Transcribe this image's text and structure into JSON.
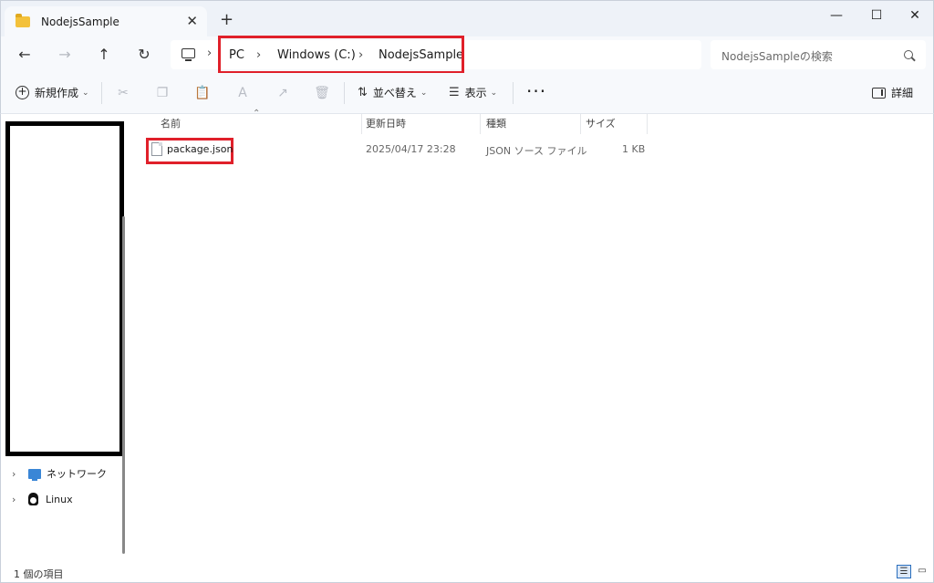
{
  "window": {
    "tab_title": "NodejsSample",
    "tab_close": "✕",
    "new_tab": "+",
    "minimize": "—",
    "maximize": "☐",
    "close": "✕"
  },
  "nav": {
    "back": "←",
    "forward": "→",
    "up": "↑",
    "refresh": "↻",
    "breadcrumb": [
      "PC",
      "Windows (C:)",
      "NodejsSample"
    ],
    "separator": "›",
    "search_placeholder": "NodejsSampleの検索"
  },
  "toolbar": {
    "new_label": "新規作成",
    "sort_label": "並べ替え",
    "view_label": "表示",
    "more": "···",
    "details_label": "詳細",
    "chevron": "⌄",
    "icons": [
      "cut-icon",
      "copy-icon",
      "paste-icon",
      "rename-icon",
      "share-icon",
      "delete-icon"
    ]
  },
  "sidebar": {
    "items": [
      {
        "label": "ネットワーク",
        "icon": "network-icon"
      },
      {
        "label": "Linux",
        "icon": "linux-icon"
      }
    ]
  },
  "columns": [
    "名前",
    "更新日時",
    "種類",
    "サイズ"
  ],
  "files": [
    {
      "name": "package.json",
      "modified": "2025/04/17 23:28",
      "type": "JSON ソース ファイル",
      "size": "1 KB"
    }
  ],
  "status": {
    "item_count": "1 個の項目"
  },
  "colors": {
    "highlight": "#e0202a",
    "chrome": "#f7f9fc"
  }
}
